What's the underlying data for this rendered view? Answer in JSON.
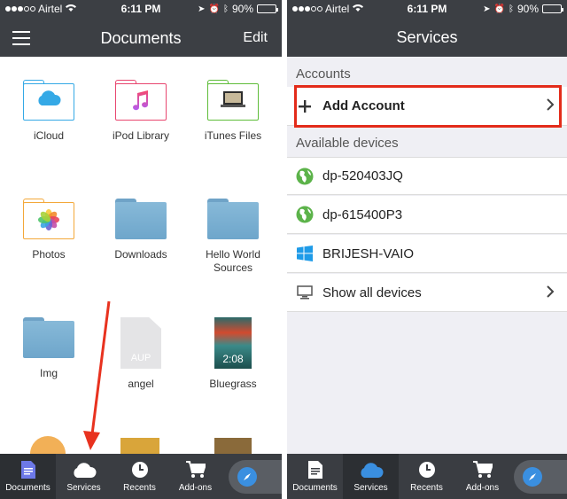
{
  "status": {
    "carrier": "Airtel",
    "time": "6:11 PM",
    "battery": "90%",
    "battery_level": 0.9
  },
  "left": {
    "title": "Documents",
    "edit_label": "Edit",
    "items": [
      {
        "label": "iCloud",
        "kind": "folder-outline",
        "color": "#35a9e6",
        "icon": "cloud-icon"
      },
      {
        "label": "iPod Library",
        "kind": "folder-outline",
        "color": "#e8466f",
        "icon": "music-note-icon"
      },
      {
        "label": "iTunes Files",
        "kind": "folder-outline",
        "color": "#5fbd3a",
        "icon": "laptop-icon"
      },
      {
        "label": "Photos",
        "kind": "folder-outline",
        "color": "#f3a83a",
        "icon": "photos-flower-icon"
      },
      {
        "label": "Downloads",
        "kind": "folder-blue"
      },
      {
        "label": "Hello World Sources",
        "kind": "folder-blue"
      },
      {
        "label": "Img",
        "kind": "folder-blue"
      },
      {
        "label": "angel",
        "kind": "file",
        "ext": "AUP"
      },
      {
        "label": "Bluegrass",
        "kind": "album",
        "duration": "2:08"
      }
    ]
  },
  "right": {
    "title": "Services",
    "accounts_header": "Accounts",
    "add_account": "Add Account",
    "devices_header": "Available devices",
    "devices": [
      {
        "name": "dp-520403JQ",
        "icon": "globe-icon"
      },
      {
        "name": "dp-615400P3",
        "icon": "globe-icon"
      },
      {
        "name": "BRIJESH-VAIO",
        "icon": "windows-icon"
      }
    ],
    "show_all": "Show all devices"
  },
  "tabs": [
    {
      "label": "Documents",
      "icon": "document-icon"
    },
    {
      "label": "Services",
      "icon": "cloud-icon"
    },
    {
      "label": "Recents",
      "icon": "clock-icon"
    },
    {
      "label": "Add-ons",
      "icon": "cart-icon"
    }
  ],
  "colors": {
    "bar": "#3c3f44",
    "accent": "#3a8fe0",
    "highlight": "#e32b1a",
    "globe": "#5cb34a",
    "windows": "#1e9be8"
  }
}
